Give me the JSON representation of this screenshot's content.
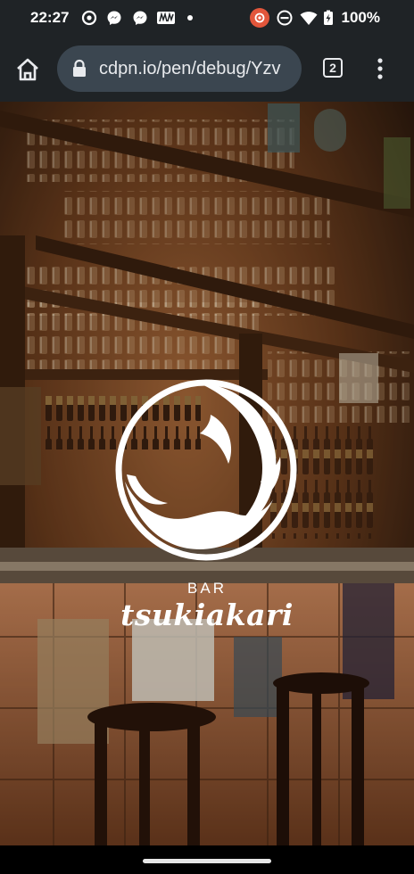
{
  "status_bar": {
    "time": "22:27",
    "battery_text": "100%",
    "icons": [
      "settings-icon",
      "messenger-icon",
      "messenger-icon",
      "news-icon",
      "dot-icon",
      "record-icon",
      "dnd-icon",
      "wifi-icon",
      "battery-icon"
    ]
  },
  "toolbar": {
    "url": "cdpn.io/pen/debug/Yzv",
    "tab_count": "2"
  },
  "hero": {
    "bar_label": "BAR",
    "brand_name": "tsukiakari"
  },
  "colors": {
    "status_bg": "#1f2326",
    "url_pill_bg": "#3b4650",
    "text_light": "#e8eaed"
  }
}
